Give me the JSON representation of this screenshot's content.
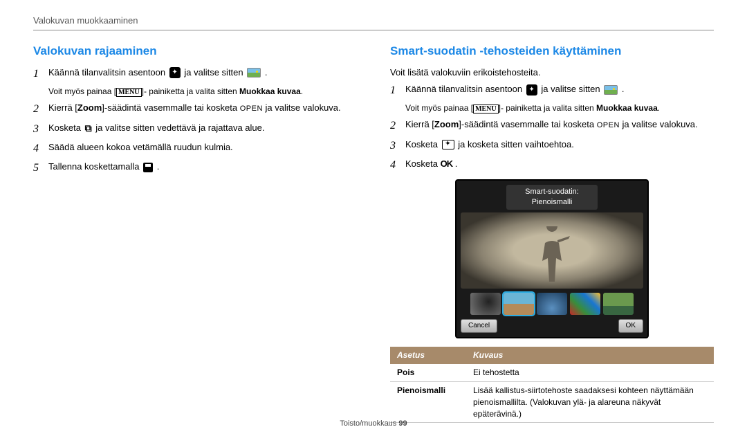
{
  "header": {
    "chapter_title": "Valokuvan muokkaaminen"
  },
  "left": {
    "heading": "Valokuvan rajaaminen",
    "steps": [
      {
        "n": "1",
        "pre": "Käännä tilanvalitsin asentoon ",
        "mid": " ja valitse sitten ",
        "post": "."
      },
      {
        "n": "2",
        "textA": "Kierrä [",
        "zoom": "Zoom",
        "textB": "]-säädintä vasemmalle tai kosketa ",
        "open": "OPEN",
        "textC": " ja valitse valokuva."
      },
      {
        "n": "3",
        "pre": "Kosketa ",
        "post": " ja valitse sitten vedettävä ja rajattava alue."
      },
      {
        "n": "4",
        "text": "Säädä alueen kokoa vetämällä ruudun kulmia."
      },
      {
        "n": "5",
        "pre": "Tallenna koskettamalla ",
        "post": "."
      }
    ],
    "note_pre": "Voit myös painaa [",
    "note_menu": "MENU",
    "note_mid": "]- painiketta ja valita sitten ",
    "note_bold": "Muokkaa kuvaa",
    "note_end": "."
  },
  "right": {
    "heading": "Smart-suodatin -tehosteiden käyttäminen",
    "intro": "Voit lisätä valokuviin erikoistehosteita.",
    "steps": [
      {
        "n": "1",
        "pre": "Käännä tilanvalitsin asentoon ",
        "mid": " ja valitse sitten ",
        "post": "."
      },
      {
        "n": "2",
        "textA": "Kierrä [",
        "zoom": "Zoom",
        "textB": "]-säädintä vasemmalle tai kosketa ",
        "open": "OPEN",
        "textC": " ja valitse valokuva."
      },
      {
        "n": "3",
        "pre": "Kosketa ",
        "post": " ja kosketa sitten vaihtoehtoa."
      },
      {
        "n": "4",
        "pre": "Kosketa ",
        "ok": "OK",
        "post": "."
      }
    ],
    "note_pre": "Voit myös painaa [",
    "note_menu": "MENU",
    "note_mid": "]- painiketta ja valita sitten ",
    "note_bold": "Muokkaa kuvaa",
    "note_end": ".",
    "preview": {
      "label": "Smart-suodatin: Pienoismalli",
      "cancel": "Cancel",
      "ok": "OK"
    },
    "table": {
      "header_setting": "Asetus",
      "header_desc": "Kuvaus",
      "rows": [
        {
          "name": "Pois",
          "desc": "Ei tehostetta"
        },
        {
          "name": "Pienoismalli",
          "desc": "Lisää kallistus-siirtotehoste saadaksesi kohteen näyttämään pienoismallilta. (Valokuvan ylä- ja alareuna näkyvät epäterävinä.)"
        }
      ]
    }
  },
  "footer": {
    "section": "Toisto/muokkaus  ",
    "page": "99"
  }
}
